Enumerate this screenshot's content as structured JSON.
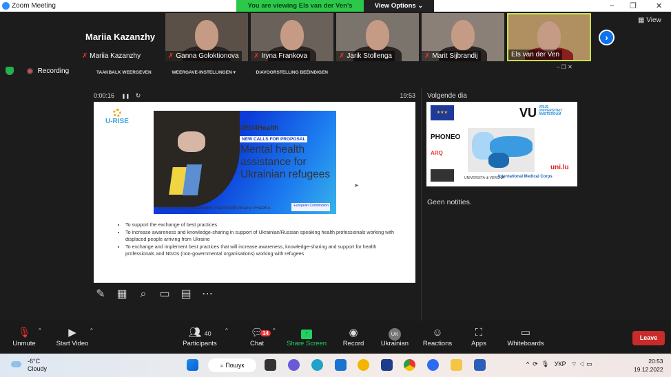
{
  "window": {
    "title": "Zoom Meeting",
    "banner": "You are viewing Els van der Ven's screen",
    "view_options": "View Options ⌄",
    "minimize": "–",
    "restore": "❐",
    "close": "✕"
  },
  "gallery": {
    "active_speaker": "Mariia Kazanzhy",
    "tiles": [
      "Mariia Kazanzhy",
      "Ganna Goloktionova",
      "Iryna Frankova",
      "Jarik Stollenga",
      "Marit Sijbrandij",
      "Els van der Ven"
    ],
    "view_label": "View",
    "next": "›"
  },
  "status": {
    "recording": "Recording"
  },
  "slideshow": {
    "toolbar": [
      "TAAKBALK WEERGEVEN",
      "WEERGAVE-INSTELLINGEN ▾",
      "DIAVOORSTELLING BEËINDIGEN"
    ],
    "elapsed": "0:00:16",
    "clock": "19:53",
    "pause": "❚❚",
    "reset": "↻",
    "win": "–   ❐   ✕"
  },
  "slide": {
    "logo": "U-RISE",
    "banner_tag": "#EU4Health",
    "banner_call": "NEW CALLS FOR PROPOSAL",
    "banner_title": "Mental health assistance for Ukrainian refugees",
    "banner_foot": "#EU4Health #MentalHealth #StandWithUkraine #HaDEA",
    "banner_ec": "European Commission",
    "bullets": [
      "To support the exchange of best practices",
      "To increase awareness and knowledge-sharing in support of Ukrainian/Russian speaking health professionals working with displaced people arriving from Ukraine",
      "To exchange and implement best practices that will increase awareness, knowledge-sharing and support for health professionals and NGOs (non-governmental organisations) working with refugees"
    ]
  },
  "next_slide": {
    "label": "Volgende dia",
    "vu": "VU",
    "vu_sub": "VRIJE UNIVERSITEIT AMSTERDAM",
    "phoneo": "PHONEO",
    "arq": "ARQ",
    "unilu": "uni.lu",
    "imc": "International Medical Corps",
    "verona": "UNIVERSITÀ di VERONA"
  },
  "notes": "Geen notities.",
  "toolbar": {
    "unmute": "Unmute",
    "start_video": "Start Video",
    "participants": "Participants",
    "participants_count": "40",
    "chat": "Chat",
    "chat_badge": "14",
    "share": "Share Screen",
    "record": "Record",
    "language": "Ukrainian",
    "language_code": "UK",
    "reactions": "Reactions",
    "apps": "Apps",
    "whiteboards": "Whiteboards",
    "leave": "Leave"
  },
  "taskbar": {
    "temp": "-6°C",
    "weather": "Cloudy",
    "search": "⌕ Пошук",
    "lang": "УКР",
    "time": "20:53",
    "date": "19.12.2022"
  },
  "colors": {
    "accent": "#0e72ed",
    "share_green": "#23d160",
    "leave": "#c92a2a",
    "banner_green": "#2cc84a"
  }
}
